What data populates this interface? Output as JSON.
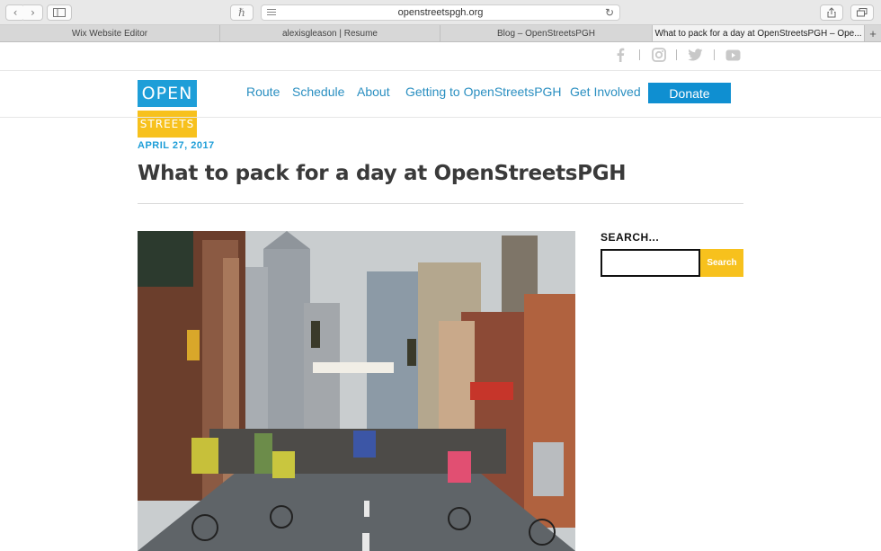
{
  "browser": {
    "url": "openstreetspgh.org",
    "tabs": [
      {
        "label": "Wix Website Editor"
      },
      {
        "label": "alexisgleason | Resume"
      },
      {
        "label": "Blog – OpenStreetsPGH"
      },
      {
        "label": "What to pack for a day at OpenStreetsPGH – Ope..."
      }
    ],
    "new_tab_label": "+"
  },
  "social": [
    "facebook-icon",
    "instagram-icon",
    "twitter-icon",
    "youtube-icon"
  ],
  "logo": {
    "top": "OPEN",
    "bottom": "STREETS",
    "blue": "#1e9ed8",
    "yellow": "#f7c11d"
  },
  "nav": {
    "items": [
      {
        "label": "Route"
      },
      {
        "label": "Schedule"
      },
      {
        "label": "About"
      },
      {
        "label": "Getting to OpenStreetsPGH"
      },
      {
        "label": "Get Involved"
      }
    ],
    "donate_label": "Donate",
    "link_color": "#2a8fc1",
    "donate_color": "#0f8fd1"
  },
  "post": {
    "date": "APRIL 27, 2017",
    "title": "What to pack for a day at OpenStreetsPGH"
  },
  "sidebar": {
    "search_heading": "SEARCH...",
    "search_value": "",
    "search_button": "Search"
  }
}
